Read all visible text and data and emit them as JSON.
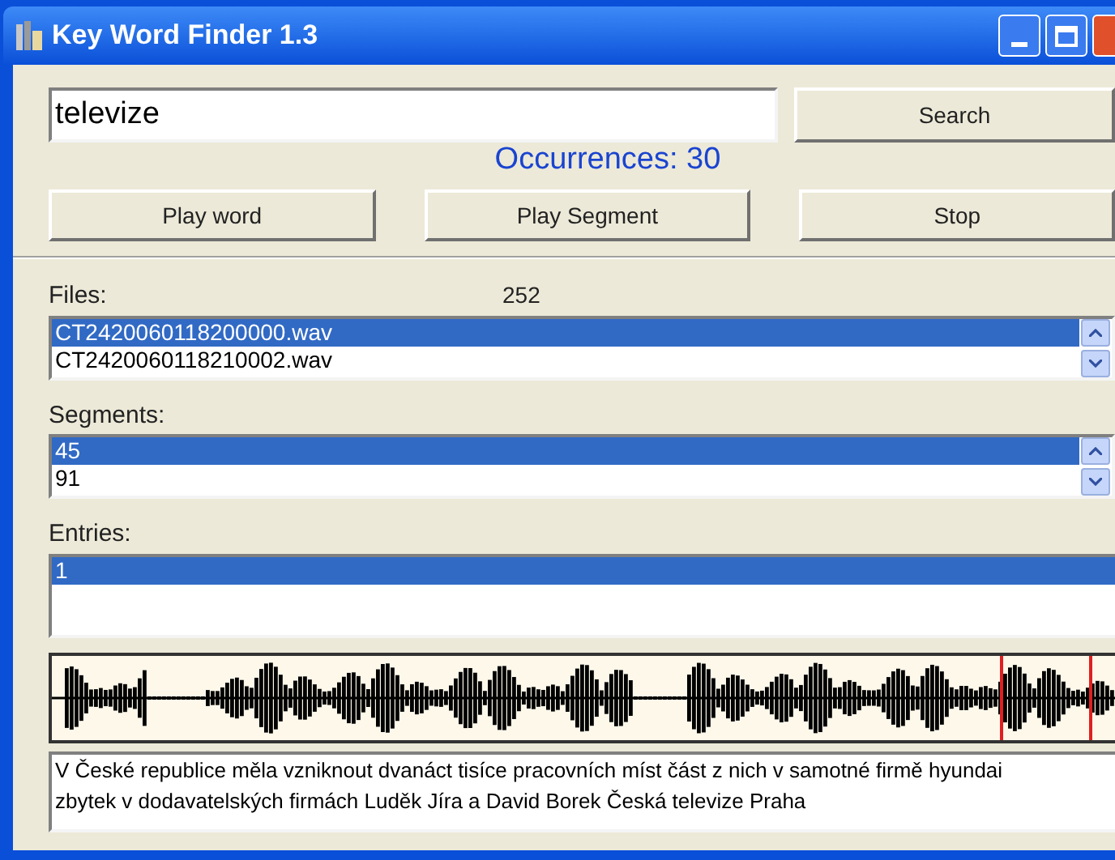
{
  "window": {
    "title": "Key Word Finder 1.3"
  },
  "search": {
    "value": "televize",
    "button": "Search"
  },
  "occurrences": "Occurrences: 30",
  "actions": [
    "Play word",
    "Play Segment",
    "Stop"
  ],
  "files": {
    "label": "Files:",
    "count": "252",
    "items": [
      {
        "text": "CT2420060118200000.wav",
        "selected": true
      },
      {
        "text": "CT2420060118210002.wav",
        "selected": false
      }
    ]
  },
  "segments": {
    "label": "Segments:",
    "items": [
      {
        "text": "45",
        "selected": true
      },
      {
        "text": "91",
        "selected": false
      }
    ]
  },
  "entries": {
    "label": "Entries:",
    "items": [
      {
        "text": "1",
        "selected": true
      }
    ]
  },
  "transcript": "V České republice měla vzniknout dvanáct tisíce pracovních míst část z nich v samotné firmě hyundai zbytek v dodavatelských firmách Luděk Jíra a David Borek Česká televize Praha"
}
